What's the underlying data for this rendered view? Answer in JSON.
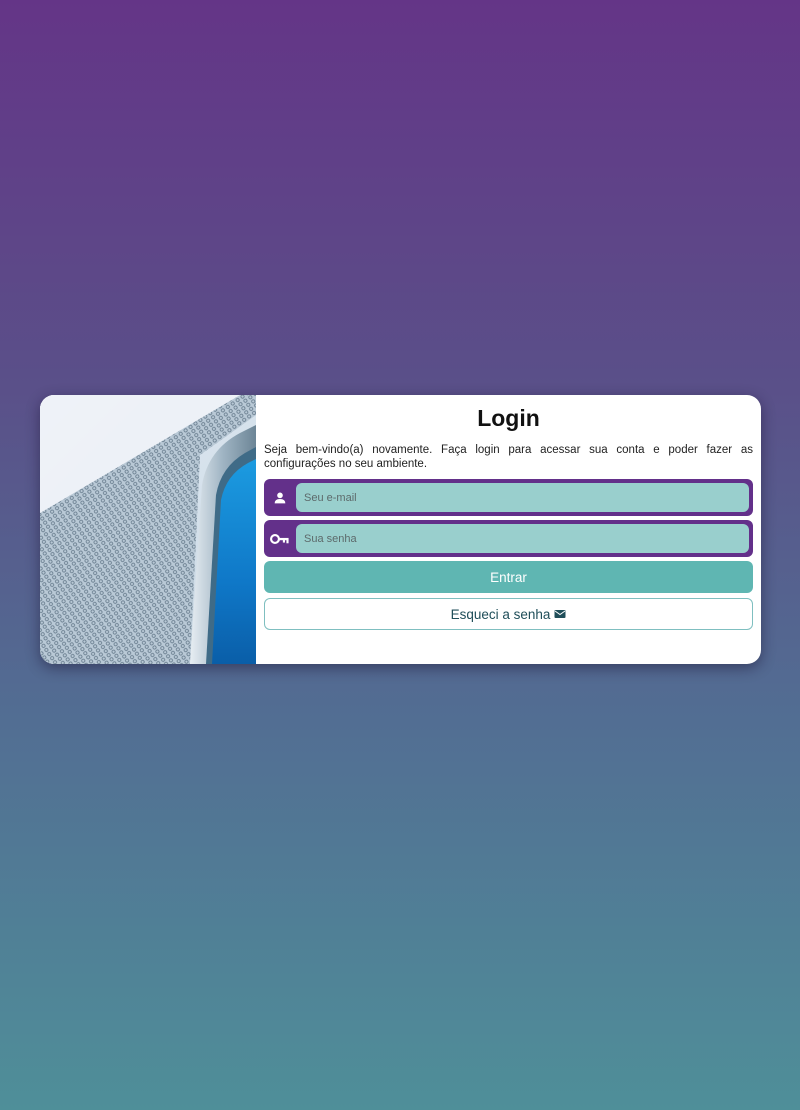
{
  "login": {
    "title": "Login",
    "subtitle": "Seja bem-vindo(a) novamente. Faça login para acessar sua conta e poder fazer as configurações no seu ambiente.",
    "email": {
      "placeholder": "Seu e-mail",
      "value": "",
      "icon": "person-icon"
    },
    "password": {
      "placeholder": "Sua senha",
      "value": "",
      "icon": "key-icon"
    },
    "submit_label": "Entrar",
    "forgot_label": "Esqueci a senha",
    "forgot_icon": "mail-icon"
  },
  "colors": {
    "field_frame": "#63308a",
    "field_fill": "#99cfcd",
    "primary_button": "#5fb6b2",
    "secondary_border": "#7fbfc0"
  }
}
